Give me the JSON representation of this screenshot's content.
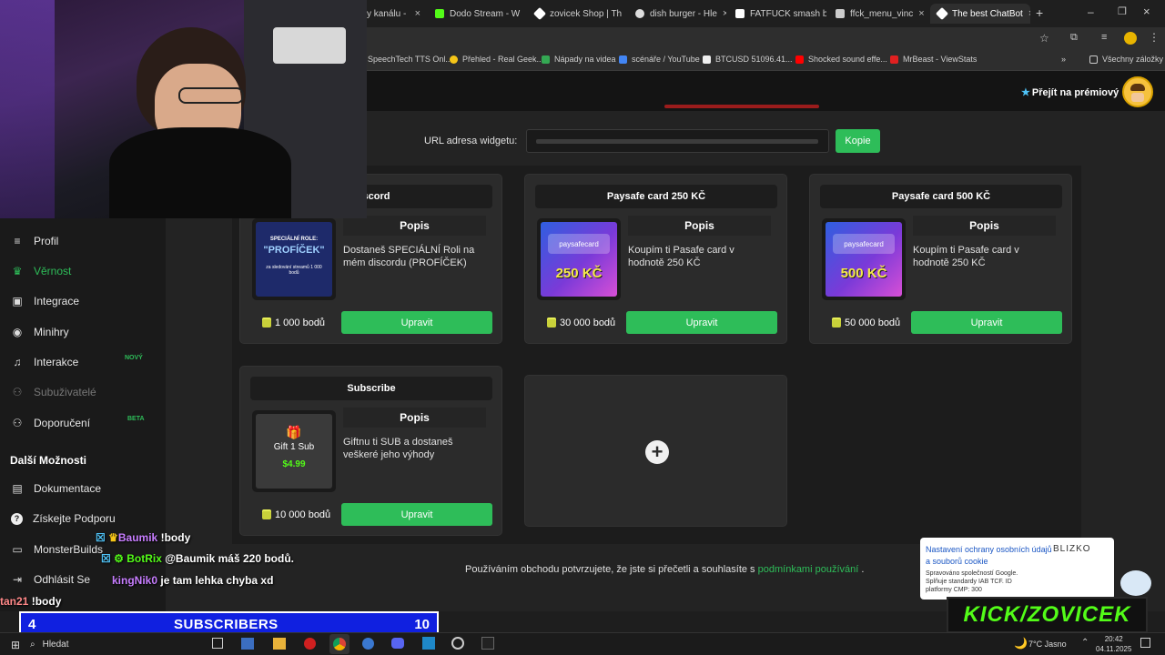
{
  "browser": {
    "tabs": [
      {
        "label": "y kanálu -",
        "color": "#888888"
      },
      {
        "label": "Dodo Stream - W",
        "color": "#53fc18"
      },
      {
        "label": "zovicek Shop | Th",
        "color": "#ffffff"
      },
      {
        "label": "dish burger - Hle",
        "color": "#dddddd"
      },
      {
        "label": "FATFUCK smash b",
        "color": "#ffffff"
      },
      {
        "label": "ffck_menu_vinc",
        "color": "#cccccc"
      },
      {
        "label": "The best ChatBot",
        "color": "#ffffff"
      }
    ],
    "bookmarks": [
      {
        "label": "SpeechTech TTS Onl...",
        "color": "#3a3a3a"
      },
      {
        "label": "Přehled - Real Geek...",
        "color": "#f5c518"
      },
      {
        "label": "Nápady na videa",
        "color": "#34a853"
      },
      {
        "label": "scénáře / YouTube",
        "color": "#4285f4"
      },
      {
        "label": "BTCUSD 51096.41...",
        "color": "#eeeeee"
      },
      {
        "label": "Shocked sound effe...",
        "color": "#ff0000"
      },
      {
        "label": "MrBeast - ViewStats",
        "color": "#e02020"
      }
    ],
    "bookmarks_all": "Všechny záložky"
  },
  "header": {
    "premium": "Přejít na prémiový"
  },
  "widget": {
    "url_label": "URL adresa widgetu:",
    "copy": "Kopie"
  },
  "sidebar": {
    "items": [
      {
        "label": "Profil",
        "icon": "≡"
      },
      {
        "label": "Věrnost",
        "icon": "♛"
      },
      {
        "label": "Integrace",
        "icon": "▣"
      },
      {
        "label": "Minihry",
        "icon": "◉"
      },
      {
        "label": "Interakce",
        "icon": "♫"
      },
      {
        "label": "Subuživatelé",
        "icon": "⚇"
      },
      {
        "label": "Doporučení",
        "icon": "⚇"
      }
    ],
    "badge_new": "NOVÝ",
    "badge_beta": "BETA",
    "section": "Další Možnosti",
    "more": [
      {
        "label": "Dokumentace",
        "icon": "▤"
      },
      {
        "label": "Získejte Podporu",
        "icon": "?"
      },
      {
        "label": "MonsterBuilds",
        "icon": "▭"
      },
      {
        "label": "Odhlásit Se",
        "icon": "⇥"
      }
    ]
  },
  "shop": {
    "popis": "Popis",
    "edit": "Upravit",
    "items": [
      {
        "title": "Discord",
        "desc": "Dostaneš SPECIÁLNÍ Roli na mém discordu (PROFÍČEK)",
        "price": "1 000 bodů",
        "img_title": "SPECIÁLNÍ ROLE:",
        "img_name": "\"PROFÍČEK\"",
        "img_sub": "za sledování streamů 1 000 bodů"
      },
      {
        "title": "Paysafe card 250 KČ",
        "desc": "Koupím ti Pasafe card v hodnotě 250 KČ",
        "price": "30 000 bodů",
        "img_amount": "250 KČ",
        "img_logo": "paysafecard"
      },
      {
        "title": "Paysafe card 500 KČ",
        "desc": "Koupím ti Pasafe card v hodnotě 250 KČ",
        "price": "50 000 bodů",
        "img_amount": "500 KČ",
        "img_logo": "paysafecard"
      },
      {
        "title": "Subscribe",
        "desc": "Giftnu ti SUB a dostaneš veškeré jeho výhody",
        "price": "10 000 bodů",
        "img_name": "Gift 1 Sub",
        "img_price": "$4.99"
      }
    ],
    "add": "+"
  },
  "footer": {
    "text": "Používáním obchodu potvrzujete, že jste si přečetli a souhlasíte s",
    "link": "podmínkami používání",
    "end": "."
  },
  "cookie": {
    "title": "Nastavení ochrany osobních údajů a souborů cookie",
    "brand": "BLIZKO",
    "line1": "Spravováno společností Google.",
    "line2": "Splňuje standardy IAB TCF. ID",
    "line3": "platformy CMP: 300"
  },
  "chat": [
    {
      "user": "Baumik",
      "msg": "!body",
      "color": "#c77dff"
    },
    {
      "user": "BotRix",
      "msg": "@Baumik máš 220 bodů.",
      "color": "#53fc18"
    },
    {
      "user": "kingNik0",
      "msg": "je tam lehka chyba xd",
      "color": "#c77dff"
    },
    {
      "user": "tan21",
      "msg": "!body",
      "color": "#ff8888"
    }
  ],
  "overlay": {
    "left_count": "4",
    "label": "SUBSCRIBERS",
    "right_count": "10",
    "kick": "KICK/ZOVICEK"
  },
  "taskbar": {
    "search": "Hledat",
    "weather": "7°C",
    "weather_desc": "Jasno",
    "time": "20:42",
    "date": "04.11.2025"
  },
  "colors": {
    "accent": "#2ebd59",
    "kick": "#53fc18"
  }
}
